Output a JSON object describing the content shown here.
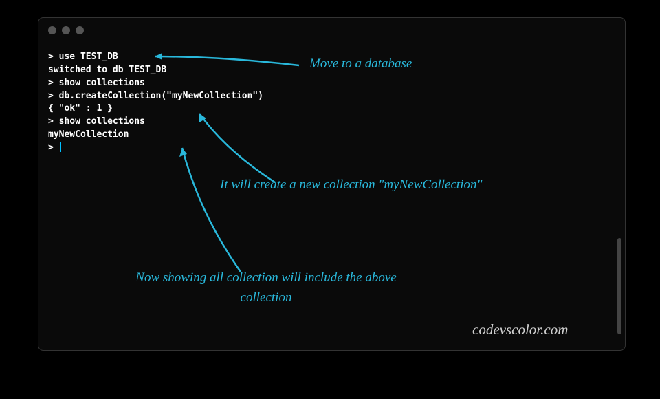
{
  "terminal": {
    "line1": "> use TEST_DB",
    "line2": "switched to db TEST_DB",
    "line3": "> show collections",
    "line4": "> db.createCollection(\"myNewCollection\")",
    "line5": "{ \"ok\" : 1 }",
    "line6": "> show collections",
    "line7": "myNewCollection",
    "line8": "> "
  },
  "annotations": {
    "a1": "Move to a database",
    "a2": "It will create a new collection \"myNewCollection\"",
    "a3": "Now showing all collection will include the above collection"
  },
  "watermark": "codevscolor.com",
  "colors": {
    "annotation": "#29b8db",
    "terminal_fg": "#ffffff",
    "terminal_bg": "#0a0a0a",
    "page_bg": "#000000"
  }
}
